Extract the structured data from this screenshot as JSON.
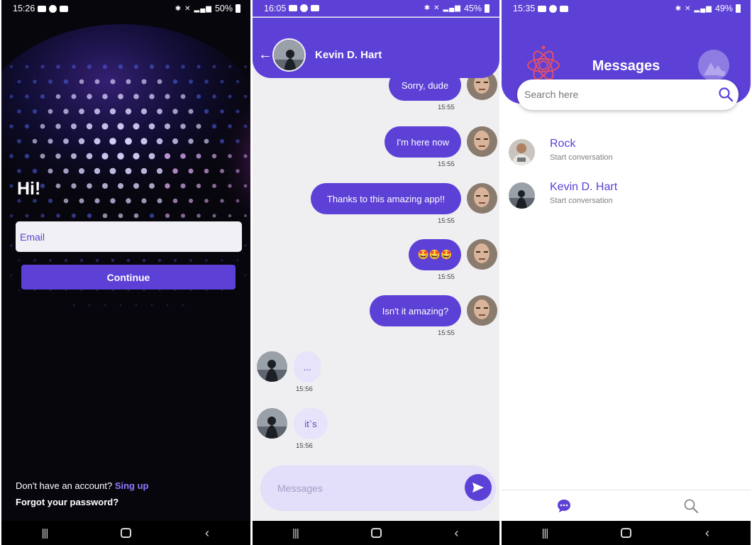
{
  "login": {
    "status_time": "15:26",
    "status_battery": "50%",
    "greeting": "Hi!",
    "email_placeholder": "Email",
    "continue_label": "Continue",
    "signup_prompt": "Don't have an account?",
    "signup_link": "Sing up",
    "forgot_password": "Forgot your password?"
  },
  "chat": {
    "status_time": "16:05",
    "status_battery": "45%",
    "contact_name": "Kevin D. Hart",
    "messages": [
      {
        "direction": "out",
        "text": "Sorry, dude",
        "time": "15:55"
      },
      {
        "direction": "out",
        "text": "I'm here now",
        "time": "15:55"
      },
      {
        "direction": "out",
        "text": "Thanks to this amazing app!!",
        "time": "15:55"
      },
      {
        "direction": "out",
        "text": "🤩🤩🤩",
        "time": "15:55"
      },
      {
        "direction": "out",
        "text": "Isn't it amazing?",
        "time": "15:55"
      },
      {
        "direction": "in",
        "text": "...",
        "time": "15:56"
      },
      {
        "direction": "in",
        "text": "it`s",
        "time": "15:56"
      }
    ],
    "compose_placeholder": "Messages"
  },
  "messages_list": {
    "status_time": "15:35",
    "status_battery": "49%",
    "title": "Messages",
    "search_placeholder": "Search here",
    "contacts": [
      {
        "name": "Rock",
        "subtitle": "Start conversation"
      },
      {
        "name": "Kevin D. Hart",
        "subtitle": "Start conversation"
      }
    ]
  },
  "colors": {
    "accent": "#5d40d6",
    "incoming_bubble": "#e7e3fb",
    "chat_background": "#efeff1"
  },
  "icons": [
    "back-arrow-icon",
    "send-icon",
    "search-icon",
    "chat-bubble-icon",
    "atom-logo-icon",
    "camera-icon"
  ]
}
